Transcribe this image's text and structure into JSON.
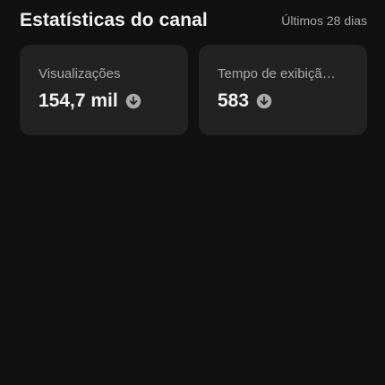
{
  "header": {
    "title": "Estatísticas do canal",
    "period": "Últimos 28 dias"
  },
  "cards": [
    {
      "label": "Visualizações",
      "value": "154,7 mil",
      "trend_icon": "arrow-down-circle-icon"
    },
    {
      "label": "Tempo de exibiçã…",
      "value": "583",
      "trend_icon": "arrow-down-circle-icon"
    }
  ],
  "colors": {
    "background": "#111111",
    "card": "#222222",
    "text_primary": "#f1f1f1",
    "text_secondary": "#aaaaaa"
  }
}
